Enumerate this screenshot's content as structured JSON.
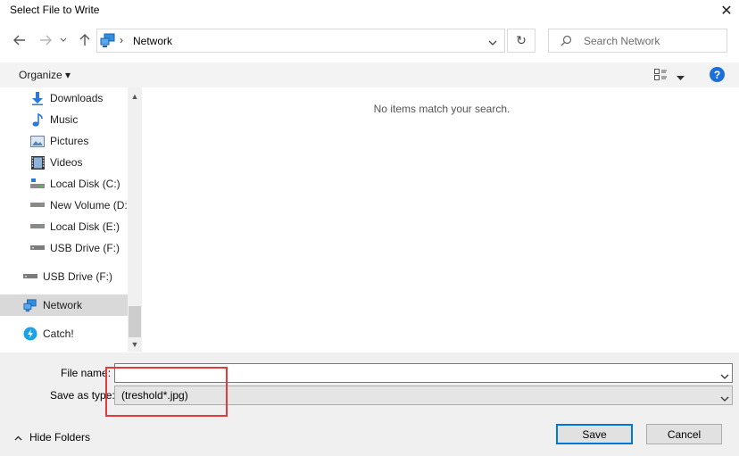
{
  "window": {
    "title": "Select File to Write"
  },
  "address": {
    "location": "Network"
  },
  "search": {
    "placeholder": "Search Network"
  },
  "toolbar": {
    "organize_label": "Organize ▾",
    "help_label": "?"
  },
  "sidebar": {
    "items": [
      {
        "label": "Downloads",
        "icon": "downloads-icon"
      },
      {
        "label": "Music",
        "icon": "music-icon"
      },
      {
        "label": "Pictures",
        "icon": "pictures-icon"
      },
      {
        "label": "Videos",
        "icon": "videos-icon"
      },
      {
        "label": "Local Disk (C:)",
        "icon": "drive-icon"
      },
      {
        "label": "New Volume (D:)",
        "icon": "drive-icon"
      },
      {
        "label": "Local Disk (E:)",
        "icon": "drive-icon"
      },
      {
        "label": "USB Drive (F:)",
        "icon": "usb-drive-icon"
      },
      {
        "label": "USB Drive (F:)",
        "icon": "usb-drive-icon"
      },
      {
        "label": "Network",
        "icon": "network-icon",
        "selected": true
      },
      {
        "label": "Catch!",
        "icon": "catch-icon"
      }
    ]
  },
  "content": {
    "empty_message": "No items match your search."
  },
  "form": {
    "file_name_label": "File name:",
    "file_name_value": "",
    "save_as_type_label": "Save as type:",
    "save_as_type_value": "(treshold*.jpg)"
  },
  "footer": {
    "hide_folders_label": "Hide Folders",
    "save_label": "Save",
    "cancel_label": "Cancel"
  },
  "colors": {
    "accent": "#0078d7",
    "highlight": "#e23b3b",
    "selected": "#d9d9d9"
  }
}
